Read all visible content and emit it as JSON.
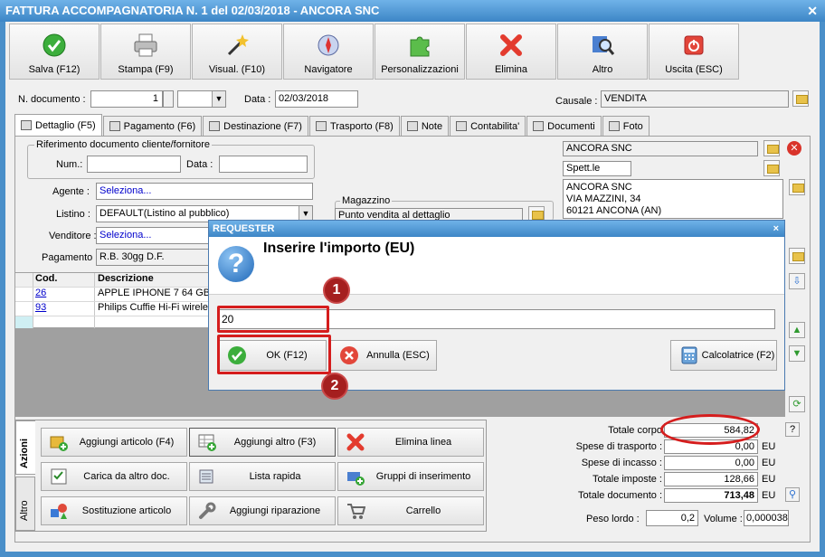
{
  "window": {
    "title": "FATTURA ACCOMPAGNATORIA N. 1 del 02/03/2018 - ANCORA SNC",
    "close": "✕"
  },
  "toolbar": [
    {
      "label": "Salva (F12)",
      "icon": "check-icon"
    },
    {
      "label": "Stampa (F9)",
      "icon": "printer-icon"
    },
    {
      "label": "Visual. (F10)",
      "icon": "magic-wand-icon"
    },
    {
      "label": "Navigatore",
      "icon": "compass-icon"
    },
    {
      "label": "Personalizzazioni",
      "icon": "puzzle-icon"
    },
    {
      "label": "Elimina",
      "icon": "delete-x-icon"
    },
    {
      "label": "Altro",
      "icon": "magnifier-icon"
    },
    {
      "label": "Uscita (ESC)",
      "icon": "power-icon"
    }
  ],
  "header": {
    "num_label": "N. documento :",
    "num_value": "1",
    "data_label": "Data :",
    "data_value": "02/03/2018",
    "causale_label": "Causale :",
    "causale_value": "VENDITA"
  },
  "tabs": [
    {
      "label": "Dettaglio (F5)"
    },
    {
      "label": "Pagamento (F6)"
    },
    {
      "label": "Destinazione (F7)"
    },
    {
      "label": "Trasporto (F8)"
    },
    {
      "label": "Note"
    },
    {
      "label": "Contabilita'"
    },
    {
      "label": "Documenti"
    },
    {
      "label": "Foto"
    }
  ],
  "rif": {
    "legend": "Riferimento documento cliente/fornitore",
    "num_label": "Num.:",
    "data_label": "Data :"
  },
  "fields": {
    "agente_label": "Agente :",
    "agente_value": "Seleziona...",
    "listino_label": "Listino :",
    "listino_value": "DEFAULT(Listino al pubblico)",
    "venditore_label": "Venditore :",
    "venditore_value": "Seleziona...",
    "pagamento_label": "Pagamento :",
    "pagamento_value": "R.B. 30gg D.F.",
    "magazzino_label": "Magazzino",
    "magazzino_value": "Punto vendita al dettaglio"
  },
  "cliente": {
    "name": "ANCORA SNC",
    "title": "Spett.le",
    "address": [
      "ANCORA SNC",
      "VIA MAZZINI, 34",
      "60121 ANCONA (AN)"
    ]
  },
  "grid": {
    "headers": [
      "Cod.",
      "Descrizione"
    ],
    "rows": [
      {
        "cod": "26",
        "desc": "APPLE IPHONE 7 64 GB AR"
      },
      {
        "cod": "93",
        "desc": "Philips Cuffie Hi-Fi wireless"
      }
    ]
  },
  "actions": {
    "vtabs": [
      "Azioni",
      "Altro"
    ],
    "buttons": [
      {
        "label": "Aggiungi articolo (F4)",
        "icon": "box-add-icon"
      },
      {
        "label": "Aggiungi altro (F3)",
        "icon": "table-add-icon"
      },
      {
        "label": "Elimina linea",
        "icon": "delete-x-icon"
      },
      {
        "label": "Carica da altro doc.",
        "icon": "checklist-icon"
      },
      {
        "label": "Lista rapida",
        "icon": "list-icon"
      },
      {
        "label": "Gruppi di inserimento",
        "icon": "group-add-icon"
      },
      {
        "label": "Sostituzione articolo",
        "icon": "shapes-icon"
      },
      {
        "label": "Aggiungi riparazione",
        "icon": "wrench-icon"
      },
      {
        "label": "Carrello",
        "icon": "cart-icon"
      }
    ]
  },
  "totals": {
    "rows": [
      {
        "label": "Totale corpo",
        "value": "584,82",
        "unit": ""
      },
      {
        "label": "Spese di trasporto :",
        "value": "0,00",
        "unit": "EU"
      },
      {
        "label": "Spese di incasso :",
        "value": "0,00",
        "unit": "EU"
      },
      {
        "label": "Totale imposte :",
        "value": "128,66",
        "unit": "EU"
      },
      {
        "label": "Totale documento :",
        "value": "713,48",
        "unit": "EU"
      }
    ],
    "help": "?",
    "peso_label": "Peso lordo :",
    "peso_value": "0,2",
    "volume_label": "Volume :",
    "volume_value": "0,000038"
  },
  "dialog": {
    "title": "REQUESTER",
    "close": "×",
    "prompt": "Inserire l'importo (EU)",
    "input_value": "20",
    "ok_label": "OK (F12)",
    "cancel_label": "Annulla (ESC)",
    "calc_label": "Calcolatrice (F2)"
  },
  "badges": [
    "1",
    "2"
  ],
  "colors": {
    "accent": "#3d86c6",
    "highlight": "#d51d1d",
    "badge": "#a51f1f"
  }
}
